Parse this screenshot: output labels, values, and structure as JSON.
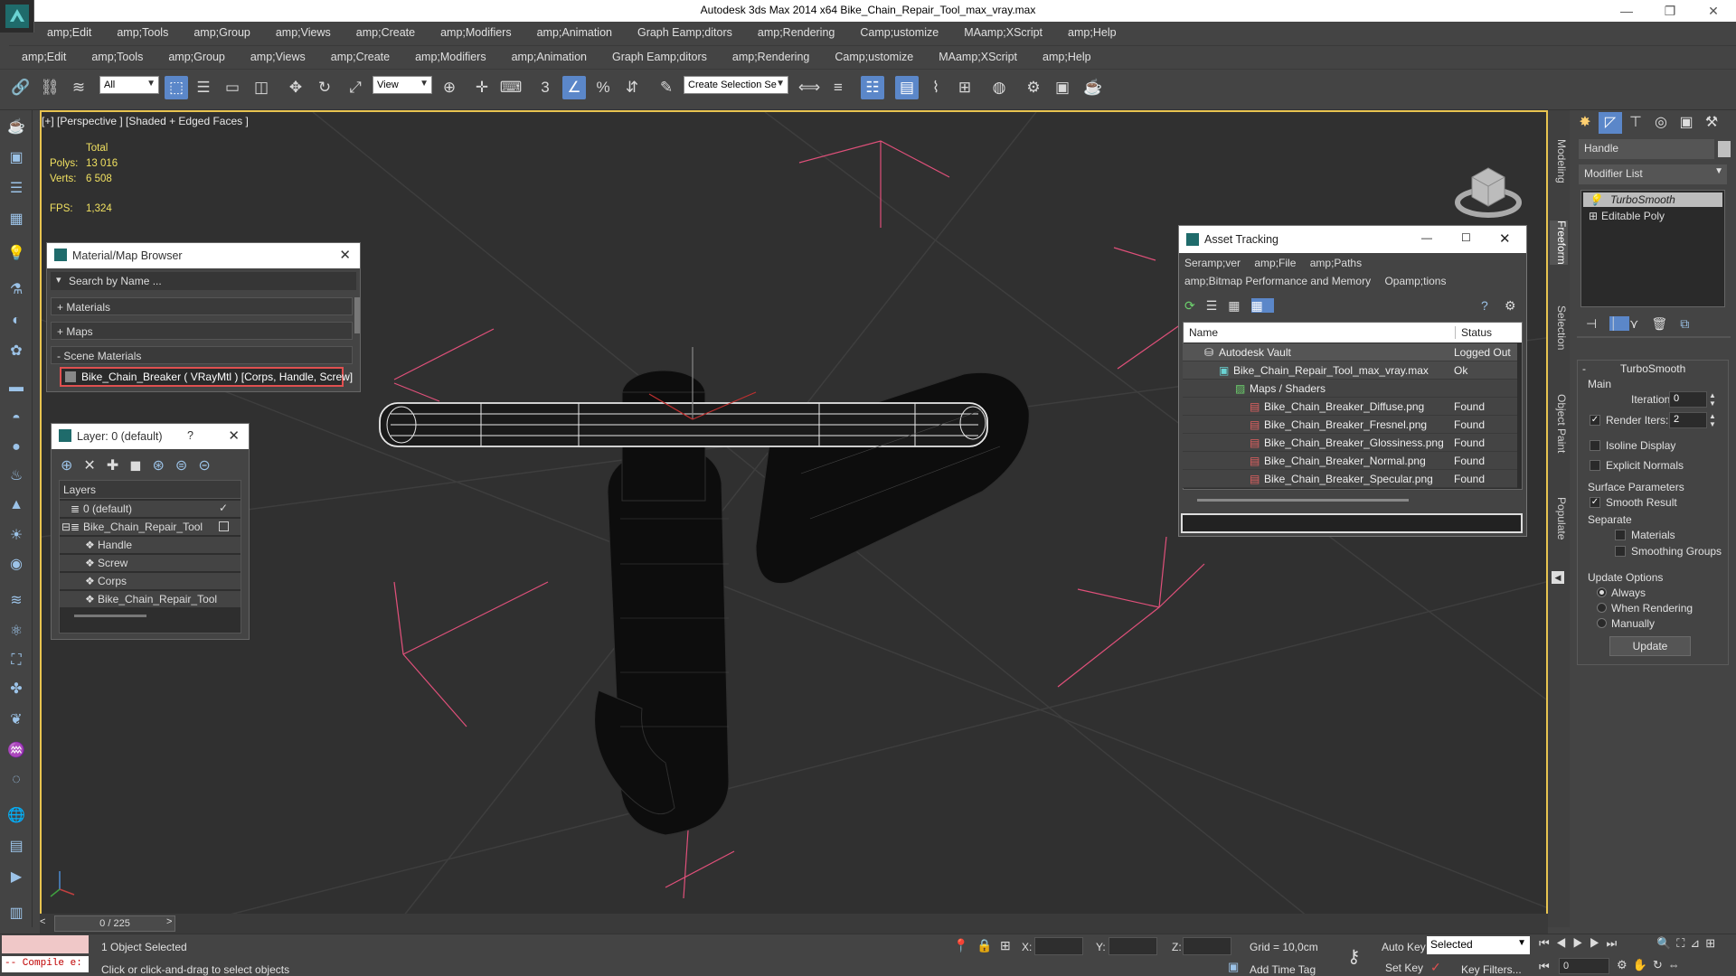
{
  "window": {
    "title": "Autodesk 3ds Max  2014 x64     Bike_Chain_Repair_Tool_max_vray.max",
    "controls": {
      "minimize": "—",
      "restore": "❐",
      "close": "✕"
    }
  },
  "menus": {
    "row1": [
      "amp;Edit",
      "amp;Tools",
      "amp;Group",
      "amp;Views",
      "amp;Create",
      "amp;Modifiers",
      "amp;Animation",
      "Graph Eamp;ditors",
      "amp;Rendering",
      "Camp;ustomize",
      "MAamp;XScript",
      "amp;Help"
    ],
    "row2": [
      "amp;Edit",
      "amp;Tools",
      "amp;Group",
      "amp;Views",
      "amp;Create",
      "amp;Modifiers",
      "amp;Animation",
      "Graph Eamp;ditors",
      "amp;Rendering",
      "Camp;ustomize",
      "MAamp;XScript",
      "amp;Help"
    ]
  },
  "toolbar": {
    "selection_filter": "All",
    "reference_coord": "View",
    "named_selection_placeholder": "Create Selection Se",
    "snap_label": "3"
  },
  "viewport": {
    "label": "[+] [Perspective ] [Shaded + Edged Faces ]",
    "stats": {
      "total_label": "Total",
      "polys_label": "Polys:",
      "polys_value": "13 016",
      "verts_label": "Verts:",
      "verts_value": "6 508",
      "fps_label": "FPS:",
      "fps_value": "1,324"
    }
  },
  "material_browser": {
    "title": "Material/Map Browser",
    "search_placeholder": "Search by Name ...",
    "sections": [
      "+ Materials",
      "+ Maps",
      "- Scene Materials"
    ],
    "scene_material": "Bike_Chain_Breaker  ( VRayMtl ) [Corps, Handle, Screw]"
  },
  "layer_panel": {
    "title": "Layer: 0 (default)",
    "help": "?",
    "header": "Layers",
    "items": [
      "0 (default)",
      "Bike_Chain_Repair_Tool",
      "Handle",
      "Screw",
      "Corps",
      "Bike_Chain_Repair_Tool"
    ]
  },
  "asset_tracking": {
    "title": "Asset Tracking",
    "menu": [
      "Seramp;ver",
      "amp;File",
      "amp;Paths"
    ],
    "menu2": [
      "amp;Bitmap Performance and Memory",
      "Opamp;tions"
    ],
    "columns": {
      "name": "Name",
      "status": "Status"
    },
    "rows": [
      {
        "name": "Autodesk Vault",
        "status": "Logged Out ..."
      },
      {
        "name": "Bike_Chain_Repair_Tool_max_vray.max",
        "status": "Ok"
      },
      {
        "name": "Maps / Shaders",
        "status": ""
      },
      {
        "name": "Bike_Chain_Breaker_Diffuse.png",
        "status": "Found"
      },
      {
        "name": "Bike_Chain_Breaker_Fresnel.png",
        "status": "Found"
      },
      {
        "name": "Bike_Chain_Breaker_Glossiness.png",
        "status": "Found"
      },
      {
        "name": "Bike_Chain_Breaker_Normal.png",
        "status": "Found"
      },
      {
        "name": "Bike_Chain_Breaker_Specular.png",
        "status": "Found"
      }
    ]
  },
  "vertical_tabs": [
    "Modeling",
    "Freeform",
    "Selection",
    "Object Paint",
    "Populate"
  ],
  "command_panel": {
    "object_name": "Handle",
    "modifier_list": "Modifier List",
    "stack": [
      "TurboSmooth",
      "Editable Poly"
    ],
    "rollout_title": "TurboSmooth",
    "main_label": "Main",
    "iterations_label": "Iterations:",
    "iterations_value": "0",
    "render_iters_label": "Render Iters:",
    "render_iters_value": "2",
    "isoline_label": "Isoline Display",
    "explicit_normals_label": "Explicit Normals",
    "surface_params_label": "Surface Parameters",
    "smooth_result_label": "Smooth Result",
    "separate_label": "Separate",
    "materials_label": "Materials",
    "smoothing_groups_label": "Smoothing Groups",
    "update_options_label": "Update Options",
    "always_label": "Always",
    "when_rendering_label": "When Rendering",
    "manually_label": "Manually",
    "update_button": "Update"
  },
  "timeline": {
    "frame": "0 / 225"
  },
  "status": {
    "script_listener": "-- Compile e:",
    "selection": "1 Object Selected",
    "prompt": "Click or click-and-drag to select objects",
    "x_label": "X:",
    "y_label": "Y:",
    "z_label": "Z:",
    "grid": "Grid = 10,0cm",
    "auto_key": "Auto Key",
    "set_key": "Set Key",
    "selected_option": "Selected",
    "key_filters": "Key Filters...",
    "add_time_tag": "Add Time Tag",
    "frame_field": "0"
  }
}
